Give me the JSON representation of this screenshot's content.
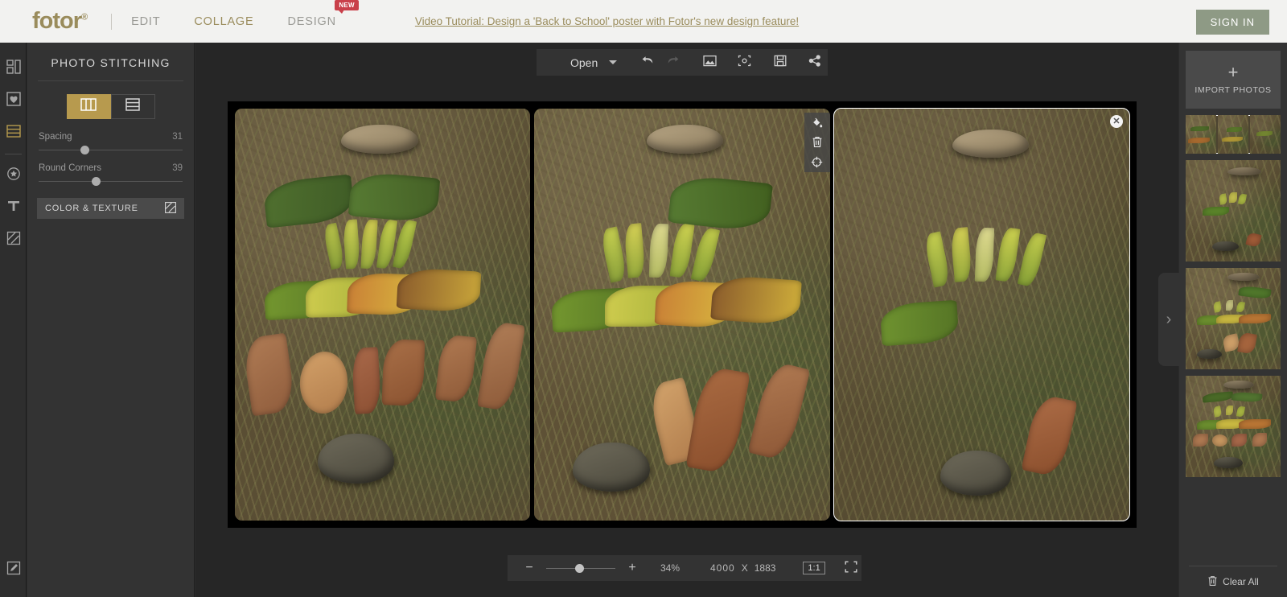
{
  "header": {
    "logo": "fotor",
    "logo_sup": "®",
    "nav": [
      {
        "label": "EDIT",
        "active": false,
        "badge": ""
      },
      {
        "label": "COLLAGE",
        "active": true,
        "badge": ""
      },
      {
        "label": "DESIGN",
        "active": false,
        "badge": "NEW"
      }
    ],
    "tutorial_link": "Video Tutorial: Design a 'Back to School' poster with Fotor's new design feature!",
    "sign_in": "SIGN IN"
  },
  "rail": {
    "items": [
      {
        "name": "layout-icon",
        "active": false
      },
      {
        "name": "favorites-icon",
        "active": false
      },
      {
        "name": "photo-stitching-icon",
        "active": true
      },
      {
        "name": "sticker-icon",
        "active": false
      },
      {
        "name": "text-icon",
        "active": false
      },
      {
        "name": "background-icon",
        "active": false
      }
    ],
    "bottom": {
      "name": "edit-icon"
    }
  },
  "panel": {
    "title": "PHOTO STITCHING",
    "layout_options": [
      {
        "name": "vertical-columns-layout",
        "active": true
      },
      {
        "name": "horizontal-rows-layout",
        "active": false
      }
    ],
    "sliders": [
      {
        "label": "Spacing",
        "value": "31",
        "percent": 31
      },
      {
        "label": "Round Corners",
        "value": "39",
        "percent": 39
      }
    ],
    "color_texture": "COLOR & TEXTURE"
  },
  "toolbar": {
    "open_label": "Open",
    "icons": [
      {
        "name": "undo-icon",
        "enabled": true
      },
      {
        "name": "redo-icon",
        "enabled": false
      },
      {
        "name": "image-icon",
        "enabled": true
      },
      {
        "name": "crop-icon",
        "enabled": true
      },
      {
        "name": "save-icon",
        "enabled": true
      },
      {
        "name": "share-icon",
        "enabled": true
      }
    ]
  },
  "cell_tools": [
    {
      "name": "fill-color-icon"
    },
    {
      "name": "delete-icon"
    },
    {
      "name": "reposition-icon"
    }
  ],
  "zoombar": {
    "minus": "−",
    "plus": "+",
    "zoom_percent": "34%",
    "width": "4000",
    "times": "X",
    "height": "1883",
    "one_to_one": "1:1",
    "slider_percent": 42
  },
  "right": {
    "import_label": "IMPORT PHOTOS",
    "import_plus": "+",
    "thumbnails": [
      {
        "name": "thumbnail-collage",
        "kind": "triple",
        "selected": true
      },
      {
        "name": "thumbnail-photo-1",
        "kind": "single",
        "selected": false
      },
      {
        "name": "thumbnail-photo-2",
        "kind": "single",
        "selected": false
      },
      {
        "name": "thumbnail-photo-3",
        "kind": "single",
        "selected": false
      }
    ],
    "clear_all": "Clear All",
    "expander": "›"
  },
  "canvas": {
    "cells": [
      {
        "name": "collage-cell-1",
        "selected": false
      },
      {
        "name": "collage-cell-2",
        "selected": false
      },
      {
        "name": "collage-cell-3",
        "selected": true
      }
    ]
  },
  "colors": {
    "brand_gold": "#9a8c5c",
    "accent_gold": "#b79a4e",
    "signin_green": "#8e9a85",
    "badge_red": "#c9404a",
    "panel_bg": "#333333",
    "workspace_bg": "#262626",
    "topbar_bg": "#f2f2f0"
  }
}
